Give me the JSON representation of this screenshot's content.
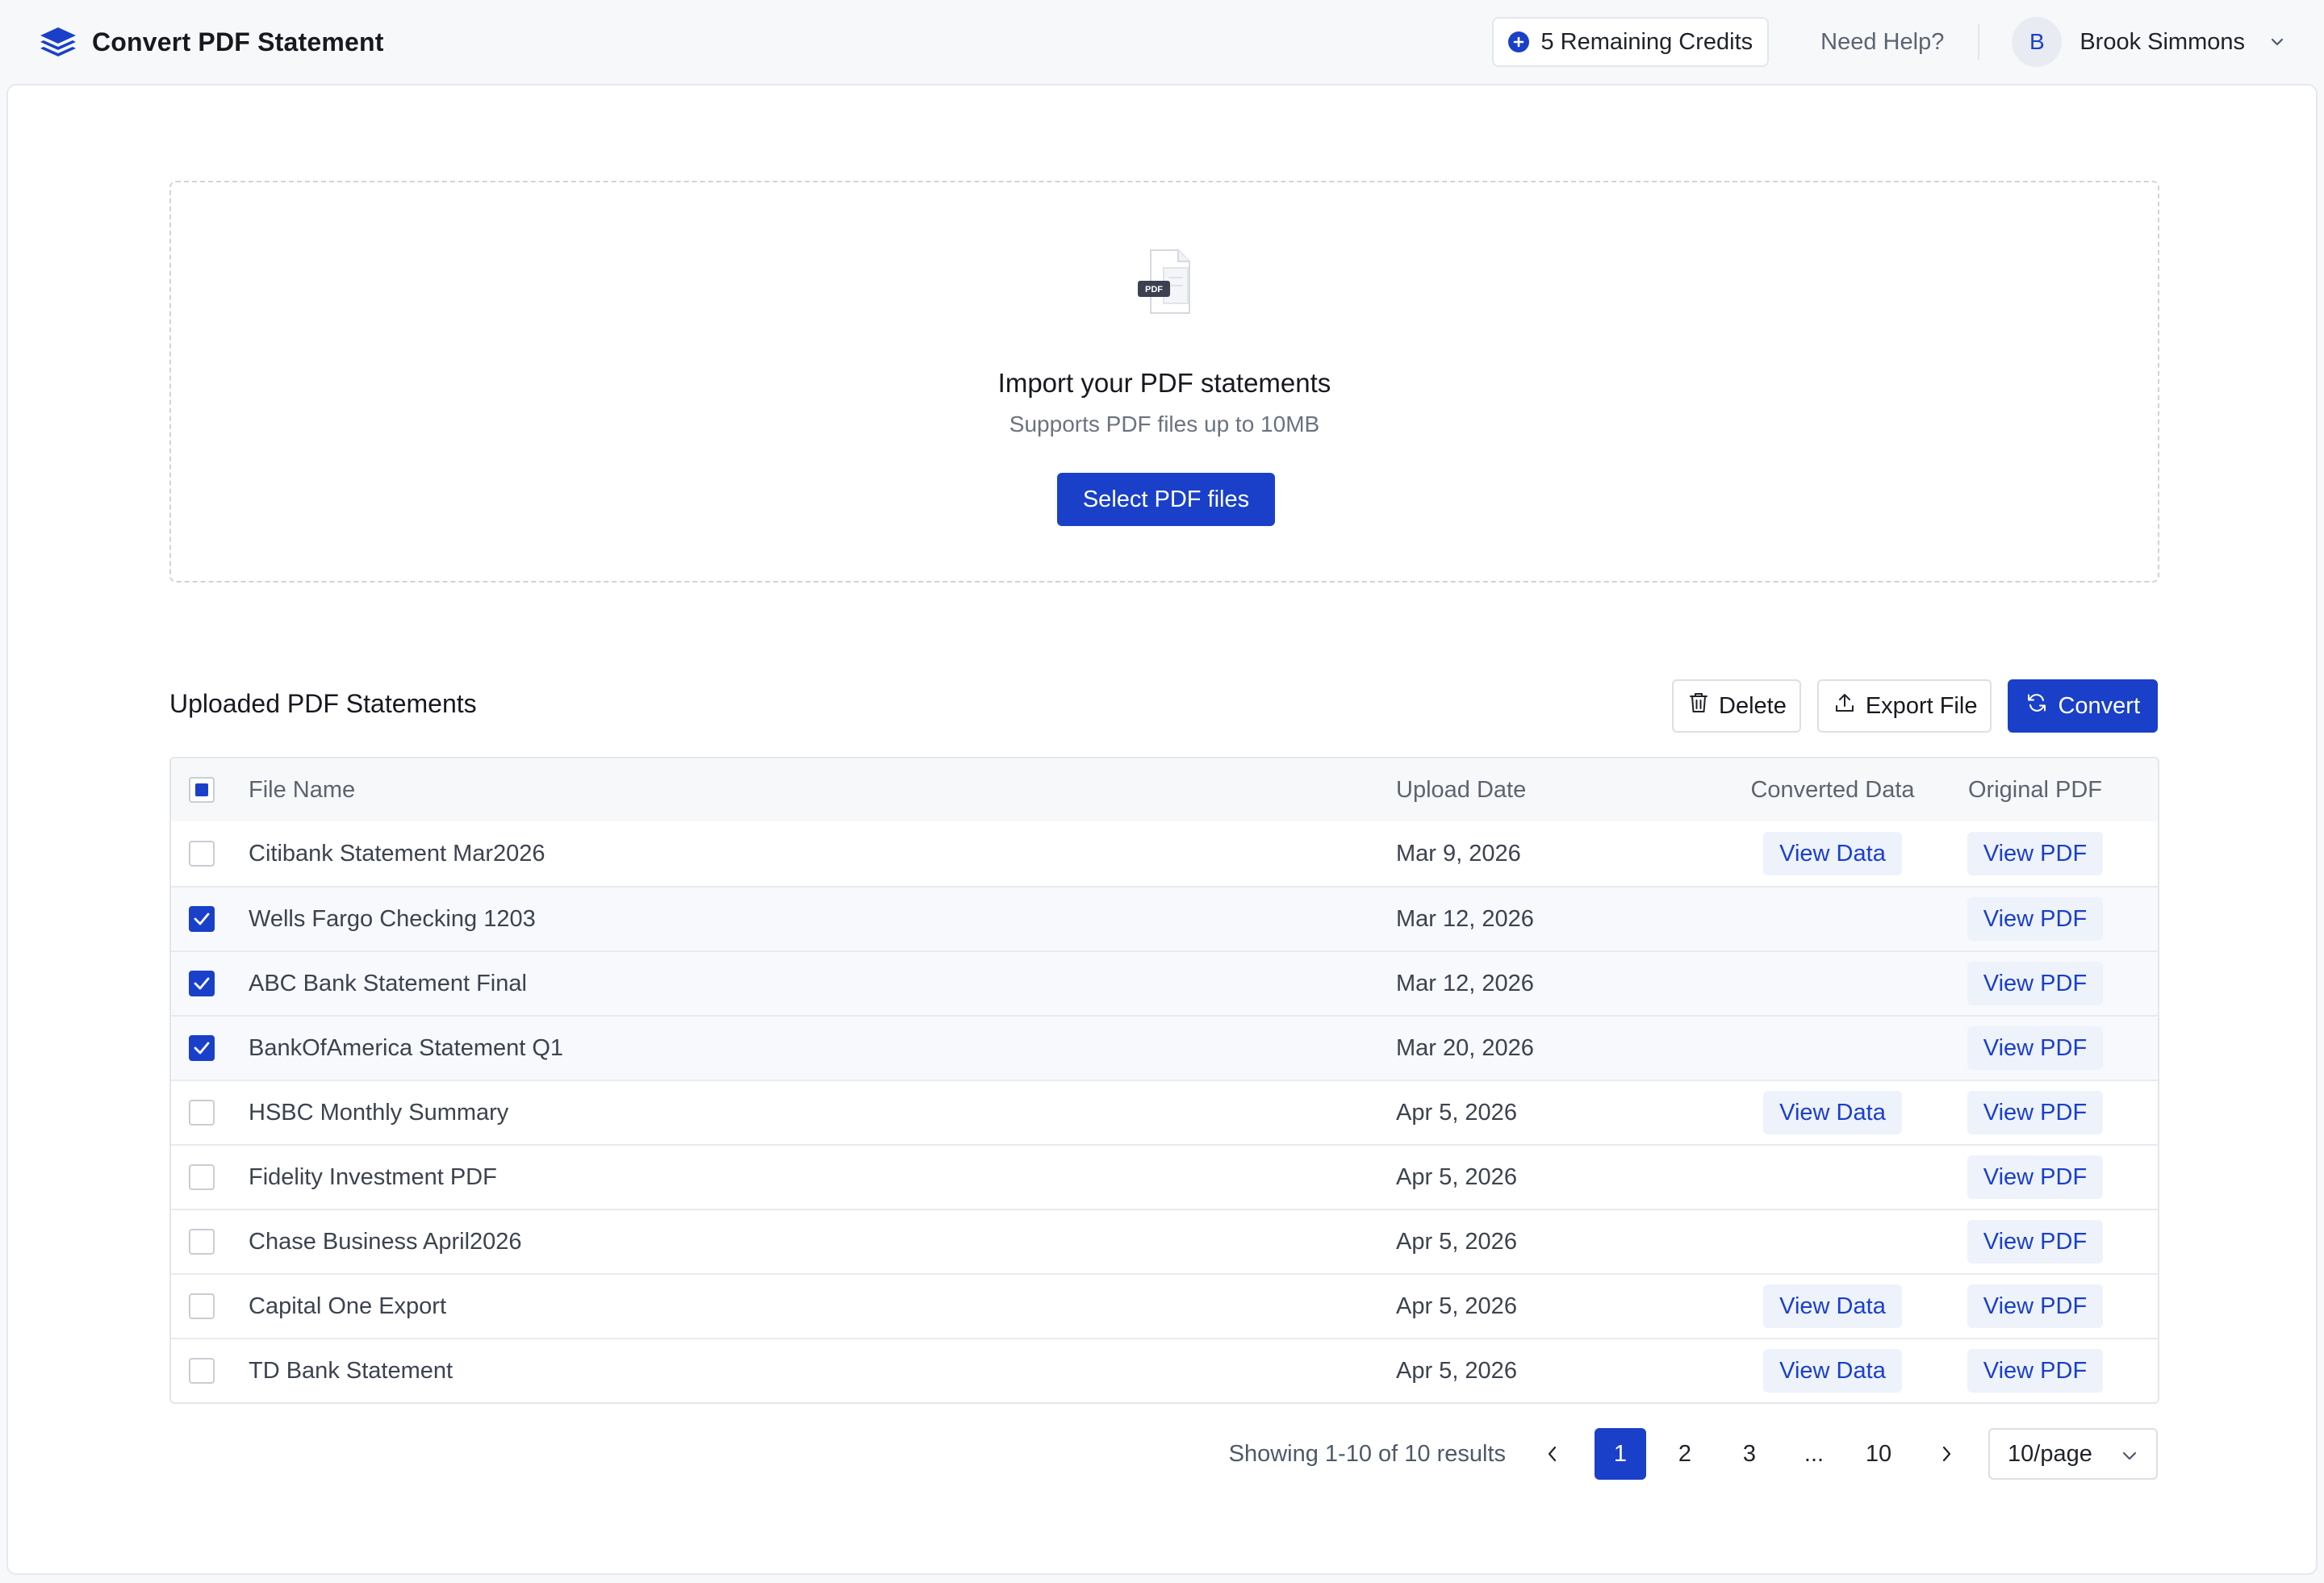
{
  "app": {
    "title": "Convert PDF Statement",
    "accent_color": "#1a40c9"
  },
  "header": {
    "credits_label": "5 Remaining Credits",
    "help_label": "Need Help?",
    "user": {
      "initial": "B",
      "name": "Brook Simmons"
    }
  },
  "upload": {
    "icon_badge": "PDF",
    "title": "Import your PDF statements",
    "subtitle": "Supports PDF files up to 10MB",
    "button_label": "Select PDF files"
  },
  "list": {
    "title": "Uploaded PDF Statements",
    "actions": {
      "delete_label": "Delete",
      "export_label": "Export File",
      "convert_label": "Convert"
    },
    "columns": {
      "name": "File Name",
      "date": "Upload Date",
      "converted": "Converted Data",
      "original": "Original PDF"
    },
    "rows": [
      {
        "name": "Citibank Statement Mar2026",
        "date": "Mar 9, 2026",
        "checked": false,
        "view_data": "View Data",
        "view_pdf": "View PDF"
      },
      {
        "name": "Wells Fargo Checking 1203",
        "date": "Mar 12, 2026",
        "checked": true,
        "view_data": "",
        "view_pdf": "View PDF"
      },
      {
        "name": "ABC Bank Statement Final",
        "date": "Mar 12, 2026",
        "checked": true,
        "view_data": "",
        "view_pdf": "View PDF"
      },
      {
        "name": "BankOfAmerica Statement Q1",
        "date": "Mar 20, 2026",
        "checked": true,
        "view_data": "",
        "view_pdf": "View PDF"
      },
      {
        "name": "HSBC Monthly Summary",
        "date": "Apr 5, 2026",
        "checked": false,
        "view_data": "View Data",
        "view_pdf": "View PDF"
      },
      {
        "name": "Fidelity Investment PDF",
        "date": "Apr 5, 2026",
        "checked": false,
        "view_data": "",
        "view_pdf": "View PDF"
      },
      {
        "name": "Chase Business April2026",
        "date": "Apr 5, 2026",
        "checked": false,
        "view_data": "",
        "view_pdf": "View PDF"
      },
      {
        "name": "Capital One Export",
        "date": "Apr 5, 2026",
        "checked": false,
        "view_data": "View Data",
        "view_pdf": "View PDF"
      },
      {
        "name": "TD Bank Statement",
        "date": "Apr 5, 2026",
        "checked": false,
        "view_data": "View Data",
        "view_pdf": "View PDF"
      }
    ]
  },
  "pagination": {
    "info": "Showing 1-10 of 10 results",
    "pages": [
      "1",
      "2",
      "3",
      "...",
      "10"
    ],
    "current": "1",
    "page_size": "10/page"
  }
}
